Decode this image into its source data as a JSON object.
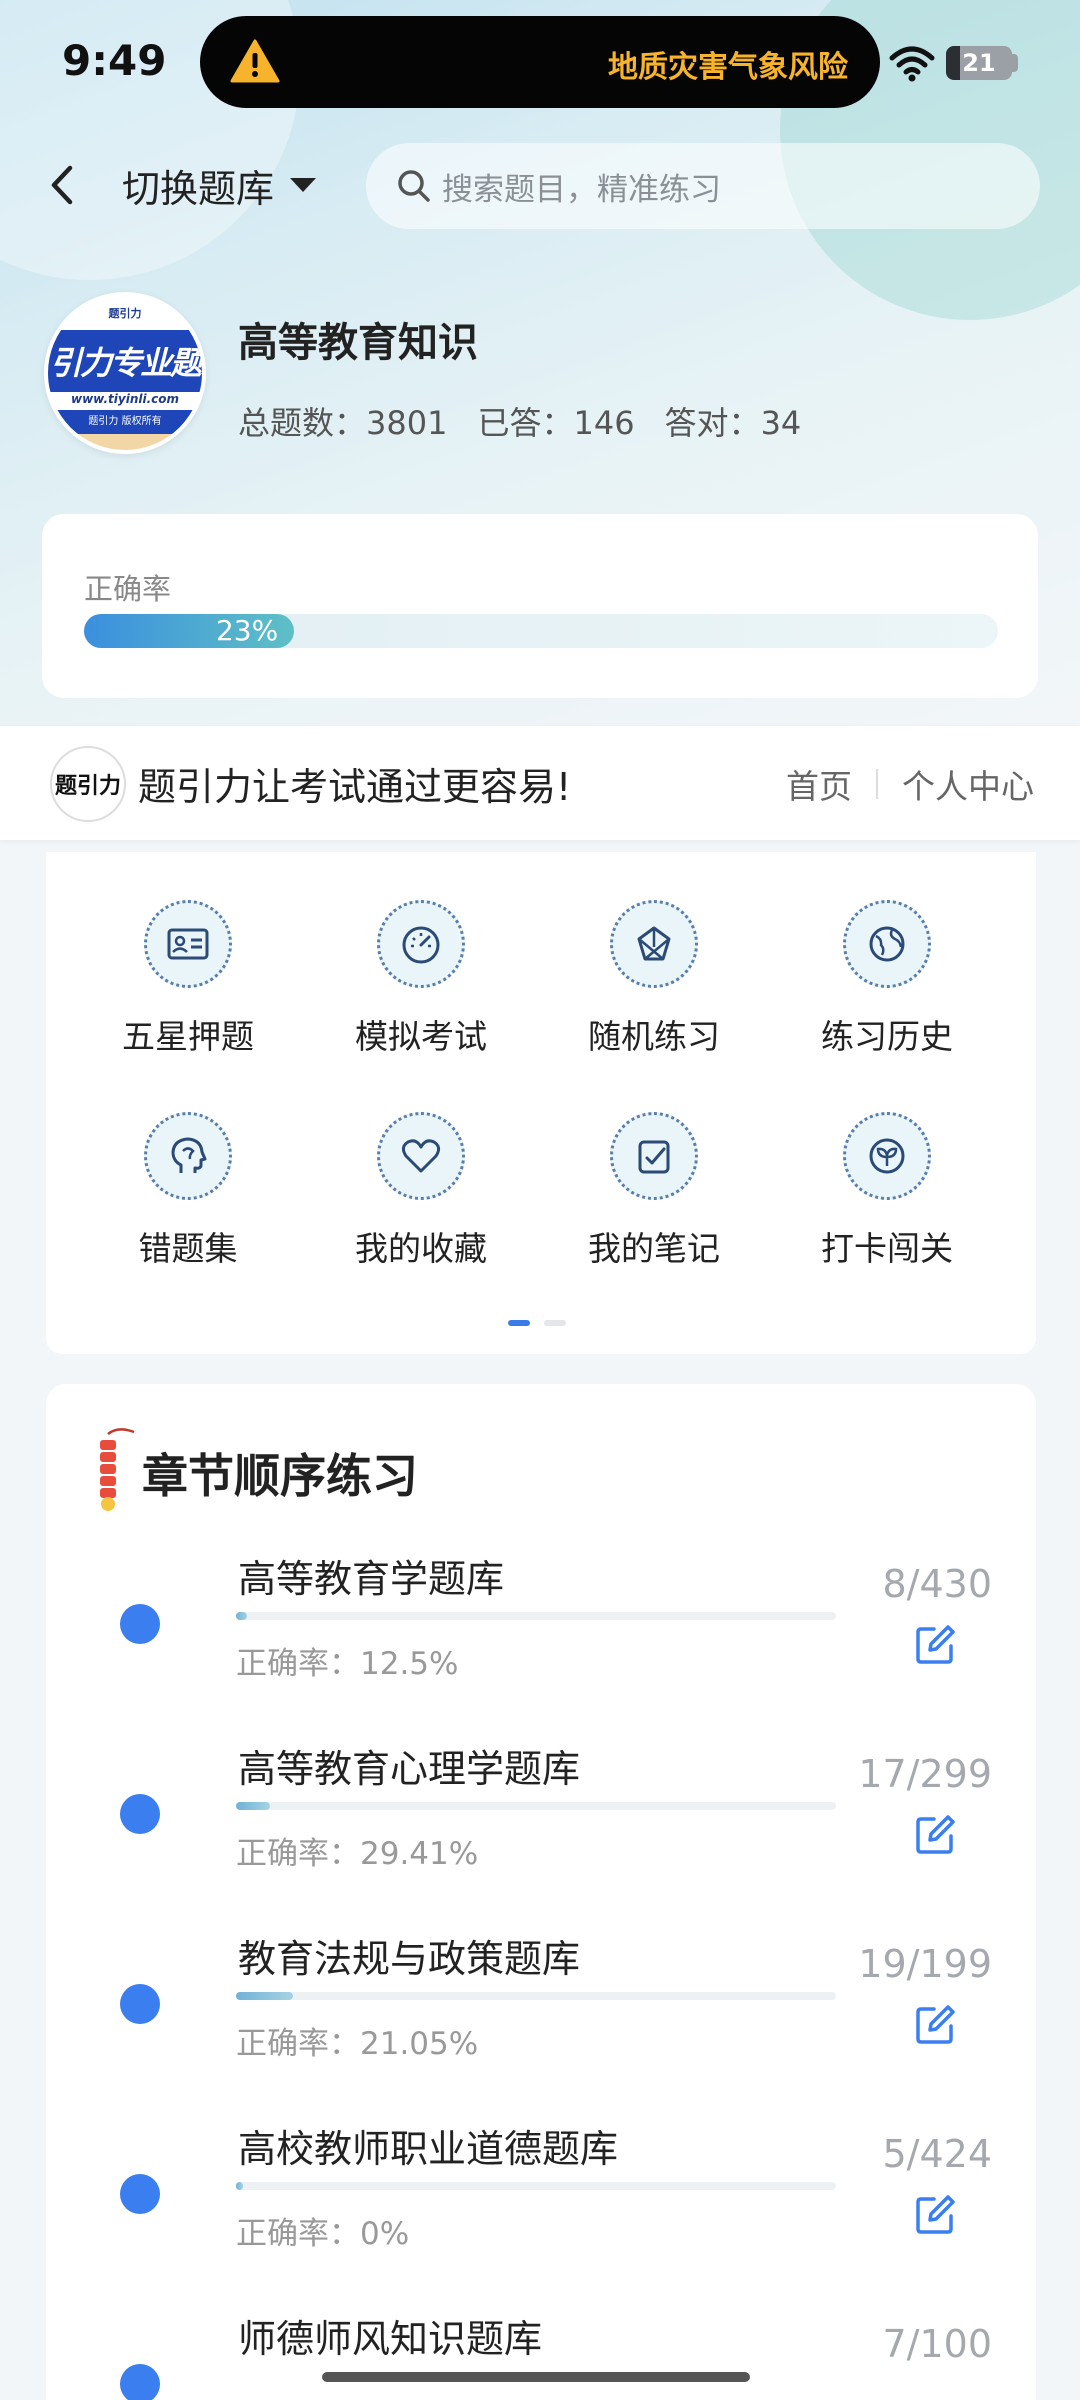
{
  "status_bar": {
    "time": "9:49",
    "alert_text": "地质灾害气象风险",
    "battery_level": "21",
    "battery_fraction": 0.21,
    "alert_color": "#f7b32b"
  },
  "header": {
    "switch_label": "切换题库",
    "search_placeholder": "搜索题目，精准练习"
  },
  "profile": {
    "logo_brand": "题引力",
    "logo_band": "引力专业题",
    "logo_url": "www.tiyinli.com",
    "logo_rights": "题引力 版权所有",
    "bank_title": "高等教育知识",
    "stats": [
      {
        "label": "总题数：",
        "value": "3801"
      },
      {
        "label": "已答：",
        "value": "146"
      },
      {
        "label": "答对：",
        "value": "34"
      }
    ]
  },
  "accuracy": {
    "label": "正确率",
    "value_text": "23%",
    "fraction": 0.23
  },
  "banner": {
    "logo_text": "题引力",
    "slogan": "题引力让考试通过更容易!",
    "links": [
      "首页",
      "个人中心"
    ]
  },
  "tools": [
    {
      "label": "五星押题",
      "icon": "id-card-icon"
    },
    {
      "label": "模拟考试",
      "icon": "speedometer-icon"
    },
    {
      "label": "随机练习",
      "icon": "shuffle-icon"
    },
    {
      "label": "练习历史",
      "icon": "globe-icon"
    },
    {
      "label": "错题集",
      "icon": "head-icon"
    },
    {
      "label": "我的收藏",
      "icon": "heart-icon"
    },
    {
      "label": "我的笔记",
      "icon": "note-check-icon"
    },
    {
      "label": "打卡闯关",
      "icon": "leaf-icon"
    }
  ],
  "pager": {
    "pages": 2,
    "active": 0
  },
  "chapters": {
    "title": "章节顺序练习",
    "accuracy_prefix": "正确率：",
    "items": [
      {
        "name": "高等教育学题库",
        "count": "8/430",
        "accuracy": "12.5%",
        "progress": 0.019
      },
      {
        "name": "高等教育心理学题库",
        "count": "17/299",
        "accuracy": "29.41%",
        "progress": 0.057
      },
      {
        "name": "教育法规与政策题库",
        "count": "19/199",
        "accuracy": "21.05%",
        "progress": 0.095
      },
      {
        "name": "高校教师职业道德题库",
        "count": "5/424",
        "accuracy": "0%",
        "progress": 0.012
      },
      {
        "name": "师德师风知识题库",
        "count": "7/100",
        "accuracy": "",
        "progress": 0.07
      }
    ]
  }
}
